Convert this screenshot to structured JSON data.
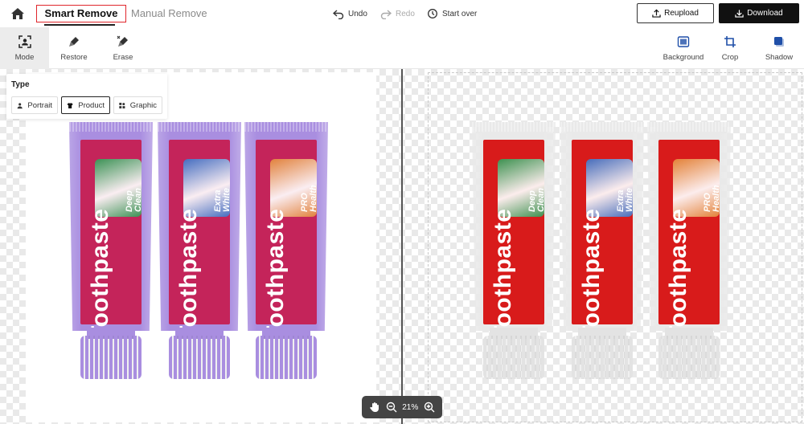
{
  "tabs": {
    "smart": "Smart Remove",
    "manual": "Manual Remove"
  },
  "history": {
    "undo": "Undo",
    "redo": "Redo",
    "start_over": "Start over"
  },
  "actions": {
    "reupload": "Reupload",
    "download": "Download"
  },
  "tools_left": [
    {
      "label": "Mode",
      "icon": "mode-icon",
      "active": true
    },
    {
      "label": "Restore",
      "icon": "restore-brush-icon",
      "active": false
    },
    {
      "label": "Erase",
      "icon": "erase-brush-icon",
      "active": false
    }
  ],
  "tools_right": [
    {
      "label": "Background",
      "icon": "background-icon"
    },
    {
      "label": "Crop",
      "icon": "crop-icon"
    },
    {
      "label": "Shadow",
      "icon": "shadow-icon"
    }
  ],
  "type_panel": {
    "title": "Type",
    "options": [
      {
        "label": "Portrait",
        "icon": "person-icon",
        "selected": false
      },
      {
        "label": "Product",
        "icon": "tshirt-icon",
        "selected": true
      },
      {
        "label": "Graphic",
        "icon": "shapes-icon",
        "selected": false
      }
    ]
  },
  "product": {
    "brand_text": "Toothpaste",
    "variants": [
      {
        "line1": "Deep",
        "line2": "Clean",
        "band": "#2f9b54"
      },
      {
        "line1": "Extra",
        "line2": "White",
        "band": "#3a74c9"
      },
      {
        "line1": "PRO",
        "line2": "Health",
        "band": "#e48a3a"
      }
    ],
    "original_colors": {
      "body": "#a98ee0",
      "label": "#c4245a",
      "cap": "#a98ee0"
    },
    "result_colors": {
      "body": "#e9e9e9",
      "label": "#d81b1b",
      "cap": "#e3e3e3"
    }
  },
  "zoom": {
    "level": "21%"
  }
}
